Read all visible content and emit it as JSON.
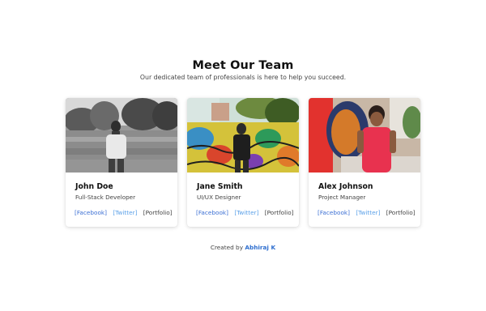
{
  "header": {
    "title": "Meet Our Team",
    "subtitle": "Our dedicated team of professionals is here to help you succeed."
  },
  "team": [
    {
      "name": "John Doe",
      "role": "Full-Stack Developer",
      "photo": "person-field-grayscale",
      "links": {
        "facebook": "[Facebook]",
        "twitter": "[Twitter]",
        "portfolio": "[Portfolio]"
      }
    },
    {
      "name": "Jane Smith",
      "role": "UI/UX Designer",
      "photo": "person-graffiti-wall",
      "links": {
        "facebook": "[Facebook]",
        "twitter": "[Twitter]",
        "portfolio": "[Portfolio]"
      }
    },
    {
      "name": "Alex Johnson",
      "role": "Project Manager",
      "photo": "person-red-shirt",
      "links": {
        "facebook": "[Facebook]",
        "twitter": "[Twitter]",
        "portfolio": "[Portfolio]"
      }
    }
  ],
  "footer": {
    "prefix": "Created by",
    "author": "Abhiraj K"
  },
  "colors": {
    "facebook_link": "#3b6fd4",
    "twitter_link": "#5aa0e8",
    "portfolio_link": "#444444",
    "author_link": "#2f6fcf"
  }
}
